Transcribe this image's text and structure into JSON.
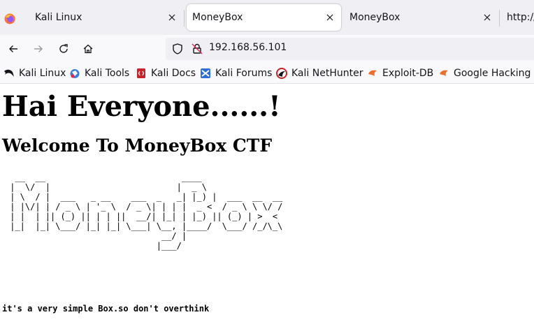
{
  "browser": {
    "tabs": [
      {
        "label": "Kali Linux"
      },
      {
        "label": "MoneyBox"
      },
      {
        "label": "MoneyBox"
      },
      {
        "label": "http://"
      }
    ],
    "url": "192.168.56.101"
  },
  "bookmarks": [
    {
      "label": "Kali Linux",
      "icon": "kali-dragon-icon"
    },
    {
      "label": "Kali Tools",
      "icon": "kali-tools-icon"
    },
    {
      "label": "Kali Docs",
      "icon": "kali-docs-icon"
    },
    {
      "label": "Kali Forums",
      "icon": "kali-forums-icon"
    },
    {
      "label": "Kali NetHunter",
      "icon": "nethunter-icon"
    },
    {
      "label": "Exploit-DB",
      "icon": "exploit-db-icon"
    },
    {
      "label": "Google Hacking D",
      "icon": "ghdb-icon"
    }
  ],
  "page": {
    "heading": "Hai Everyone......!",
    "subheading": "Welcome To MoneyBox CTF",
    "ascii_art": "  __  __                           ____\n |  \\/  |                         |  _ \\\n | \\  / |  ___   _ __    ___  _   _| |_) |  ___  __  __\n | |\\/| | / _ \\ | '_ \\  / _ \\| | | |  _ <  / _ \\ \\ \\/ /\n | |  | || (_) || | | ||  __/| |_| | |_) || (_) | >  <\n |_|  |_| \\___/ |_| |_| \\___| \\__, |____/  \\___/ /_/\\_\\\n                               __/ |\n                              |___/",
    "note": "it's a very simple Box.so don't overthink"
  }
}
